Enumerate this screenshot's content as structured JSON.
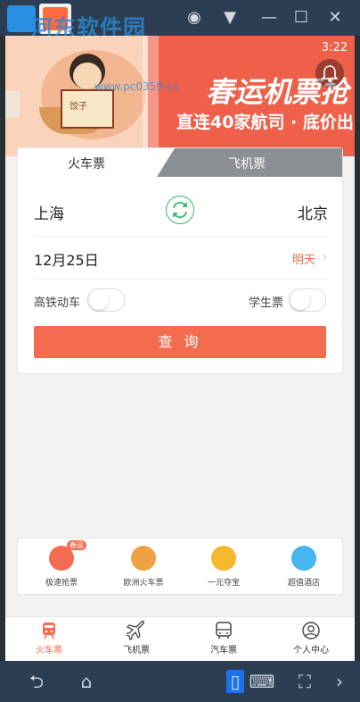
{
  "watermark": {
    "title": "河东软件园",
    "url": "www.pc0359.cn"
  },
  "status": {
    "time": "3:22"
  },
  "banner": {
    "slogan_main": "春运机票抢",
    "slogan_sub": "直连40家航司 · 底价出",
    "paper_text": "饺子"
  },
  "tabs": [
    {
      "label": "火车票"
    },
    {
      "label": "飞机票"
    }
  ],
  "route": {
    "from": "上海",
    "to": "北京"
  },
  "date": {
    "value": "12月25日",
    "relative": "明天"
  },
  "options": {
    "high_speed_label": "高铁动车",
    "student_label": "学生票"
  },
  "search": {
    "label": "查 询"
  },
  "quick_services": [
    {
      "label": "极速抢票",
      "badge": "春运",
      "color": "#f36c4f"
    },
    {
      "label": "欧洲火车票",
      "color": "#f0a242"
    },
    {
      "label": "一元夺宝",
      "color": "#f5b82e"
    },
    {
      "label": "超值酒店",
      "color": "#47b6ee"
    }
  ],
  "bottom_nav": [
    {
      "label": "火车票",
      "active": true
    },
    {
      "label": "飞机票"
    },
    {
      "label": "汽车票"
    },
    {
      "label": "个人中心"
    }
  ]
}
